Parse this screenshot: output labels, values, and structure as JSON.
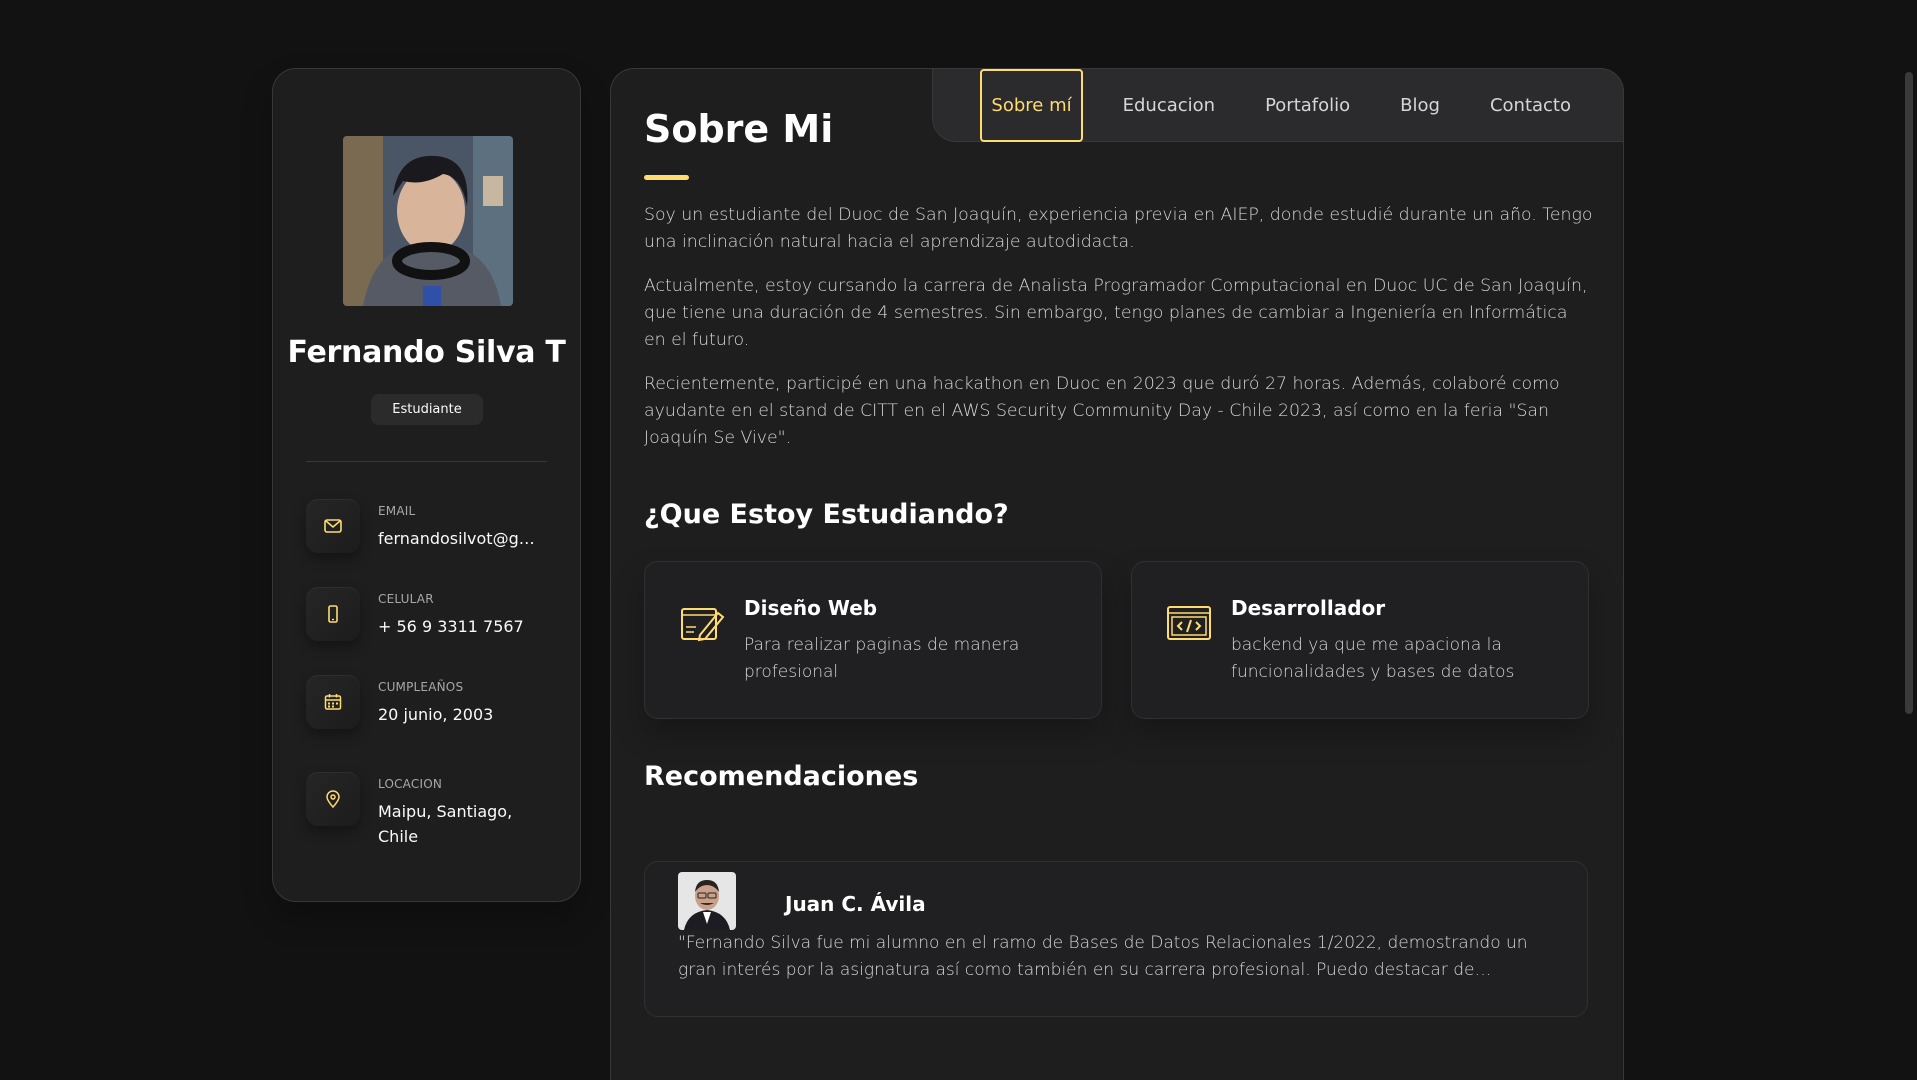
{
  "sidebar": {
    "name": "Fernando Silva T",
    "role": "Estudiante",
    "contacts": [
      {
        "title": "Email",
        "value": "fernandosilvot@gmail.com",
        "icon": "mail-icon"
      },
      {
        "title": "Celular",
        "value": "+ 56 9 3311 7567",
        "icon": "phone-icon"
      },
      {
        "title": "Cumpleaños",
        "value": "20 junio, 2003",
        "icon": "calendar-icon"
      },
      {
        "title": "Locacion",
        "value": "Maipu, Santiago, Chile",
        "icon": "location-pin-icon"
      }
    ]
  },
  "nav": {
    "items": [
      "Sobre mí",
      "Educacion",
      "Portafolio",
      "Blog",
      "Contacto"
    ],
    "active": "Sobre mí"
  },
  "about": {
    "title": "Sobre Mi",
    "paragraphs": [
      "Soy un estudiante del Duoc de San Joaquín, experiencia previa en AIEP, donde estudié durante un año. Tengo una inclinación natural hacia el aprendizaje autodidacta.",
      "Actualmente, estoy cursando la carrera de Analista Programador Computacional en Duoc UC de San Joaquín, que tiene una duración de 4 semestres. Sin embargo, tengo planes de cambiar a Ingeniería en Informática en el futuro.",
      "Recientemente, participé en una hackathon en Duoc en 2023 que duró 27 horas. Además, colaboré como ayudante en el stand de CITT en el AWS Security Community Day - Chile 2023, así como en la feria \"San Joaquín Se Vive\"."
    ]
  },
  "services": {
    "title": "¿Que Estoy Estudiando?",
    "items": [
      {
        "title": "Diseño Web",
        "text": "Para realizar paginas de manera profesional",
        "icon": "design-pencil-icon"
      },
      {
        "title": "Desarrollador",
        "text": "backend ya que me apaciona la funcionalidades y bases de datos",
        "icon": "code-window-icon"
      }
    ]
  },
  "recommendations": {
    "title": "Recomendaciones",
    "items": [
      {
        "name": "Juan C. Ávila",
        "text": "\"Fernando Silva fue mi alumno en el ramo de Bases de Datos Relacionales 1/2022, demostrando un gran interés por la asignatura así como también en su carrera profesional. Puedo destacar de Fernando su..."
      }
    ]
  },
  "colors": {
    "accent": "#ffdb70",
    "background": "#121212",
    "card": "#1e1e1f"
  }
}
